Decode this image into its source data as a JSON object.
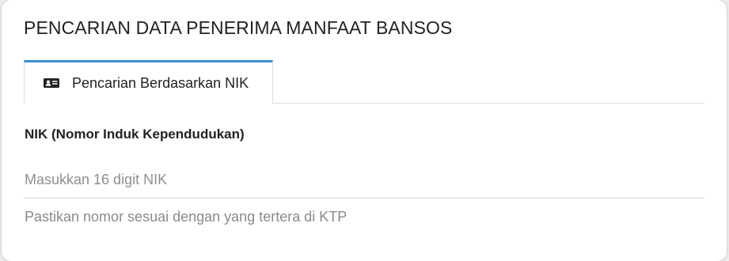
{
  "page": {
    "title": "PENCARIAN DATA PENERIMA MANFAAT BANSOS"
  },
  "tabs": [
    {
      "label": "Pencarian Berdasarkan NIK",
      "icon": "id-card-icon",
      "active": true
    }
  ],
  "form": {
    "nik_label": "NIK (Nomor Induk Kependudukan)",
    "nik_value": "",
    "nik_placeholder": "Masukkan 16 digit NIK",
    "nik_help": "Pastikan nomor sesuai dengan yang tertera di KTP"
  },
  "colors": {
    "active_tab_accent": "#3b8fd6",
    "text_primary": "#222222",
    "text_muted": "#8a8a8a"
  }
}
